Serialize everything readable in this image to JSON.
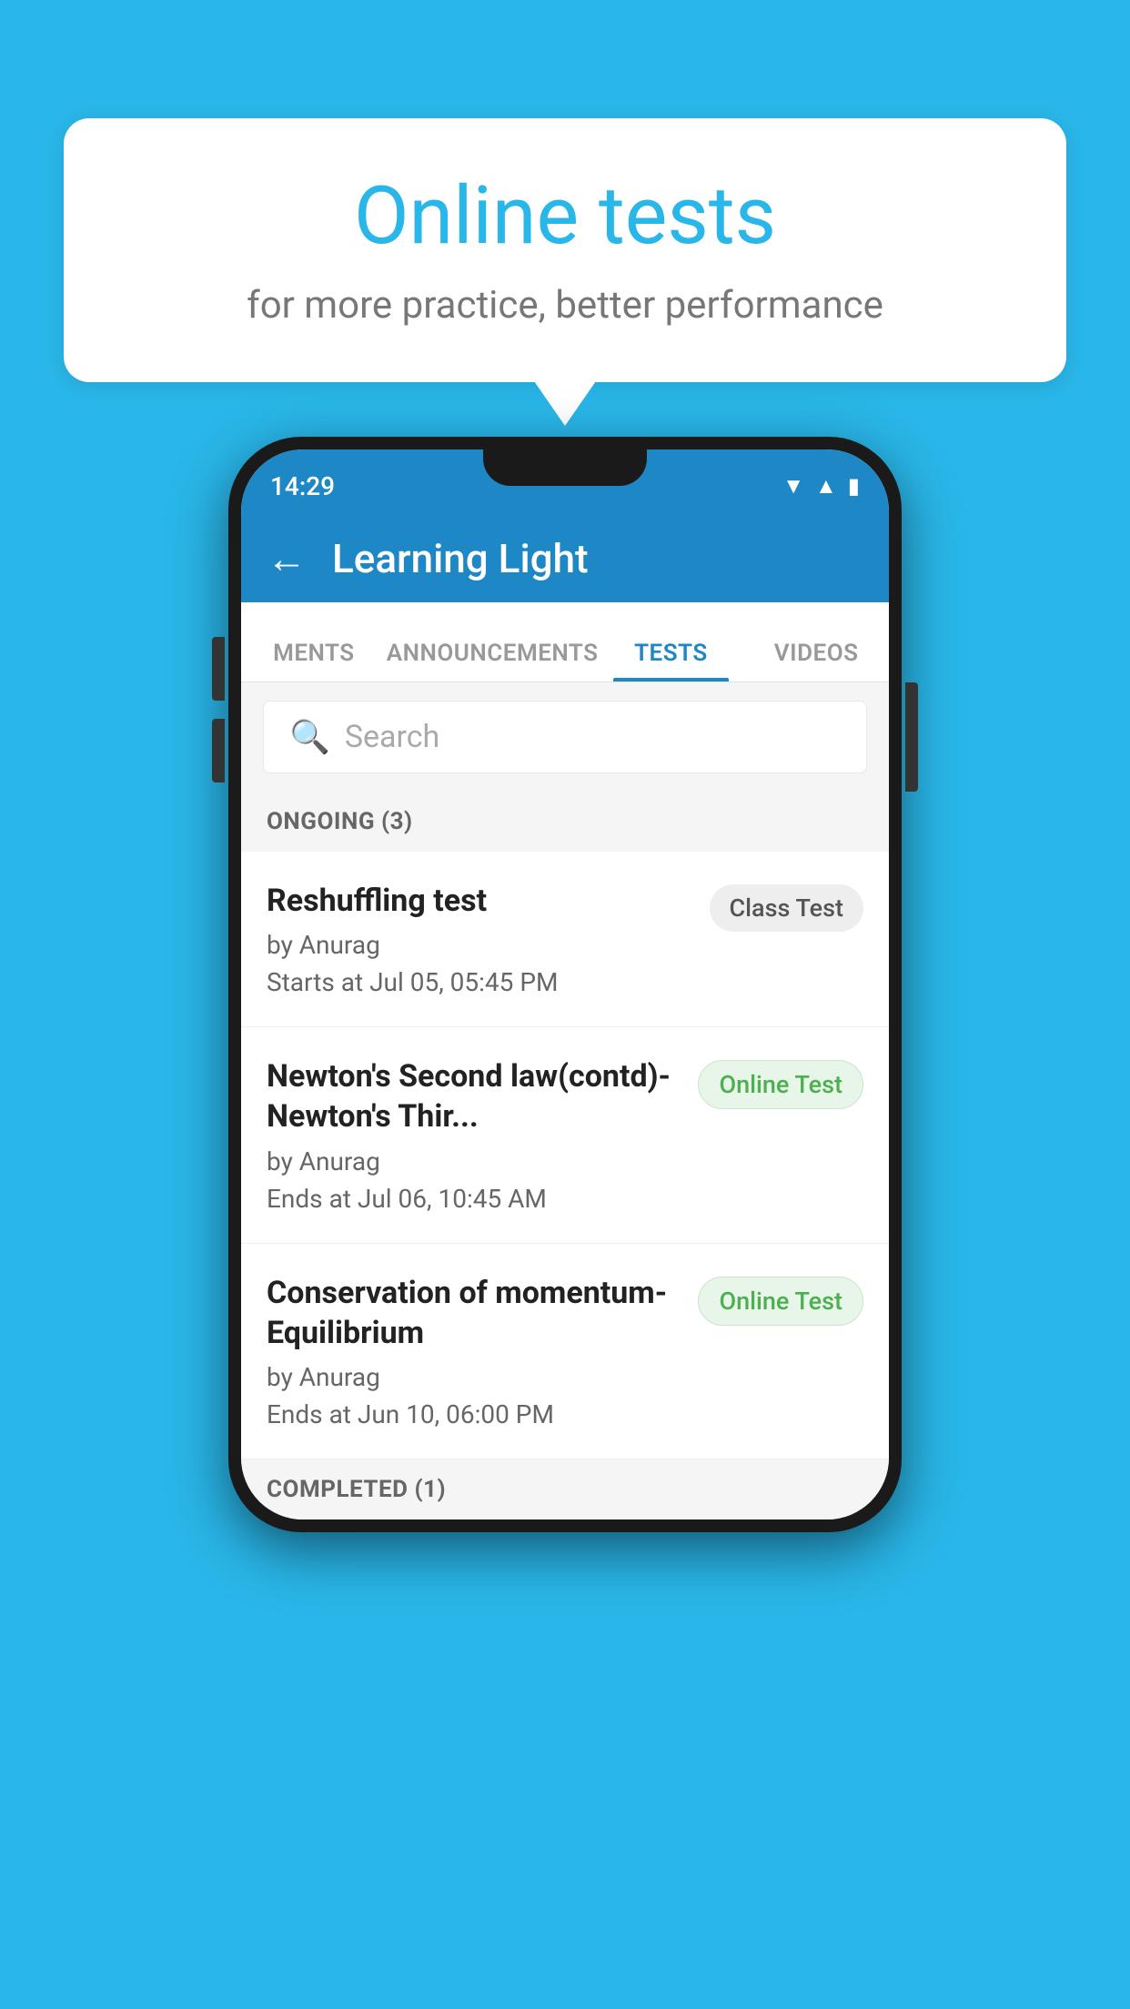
{
  "background": {
    "color": "#29b6e8"
  },
  "bubble": {
    "title": "Online tests",
    "subtitle": "for more practice, better performance"
  },
  "phone": {
    "statusBar": {
      "time": "14:29",
      "icons": [
        "wifi",
        "signal",
        "battery"
      ]
    },
    "header": {
      "title": "Learning Light",
      "backLabel": "←"
    },
    "tabs": [
      {
        "label": "MENTS",
        "active": false
      },
      {
        "label": "ANNOUNCEMENTS",
        "active": false
      },
      {
        "label": "TESTS",
        "active": true
      },
      {
        "label": "VIDEOS",
        "active": false
      }
    ],
    "search": {
      "placeholder": "Search"
    },
    "sections": [
      {
        "header": "ONGOING (3)",
        "items": [
          {
            "title": "Reshuffling test",
            "author": "by Anurag",
            "time": "Starts at  Jul 05, 05:45 PM",
            "badge": "Class Test",
            "badgeType": "class"
          },
          {
            "title": "Newton's Second law(contd)-Newton's Thir...",
            "author": "by Anurag",
            "time": "Ends at  Jul 06, 10:45 AM",
            "badge": "Online Test",
            "badgeType": "online"
          },
          {
            "title": "Conservation of momentum-Equilibrium",
            "author": "by Anurag",
            "time": "Ends at  Jun 10, 06:00 PM",
            "badge": "Online Test",
            "badgeType": "online"
          }
        ]
      }
    ],
    "completedHeader": "COMPLETED (1)"
  }
}
